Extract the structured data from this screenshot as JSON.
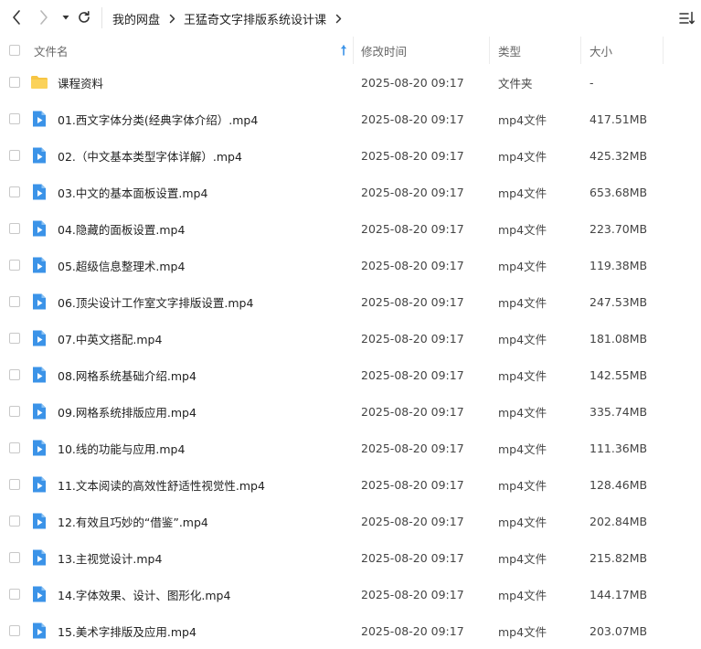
{
  "nav": {
    "back_icon": "chevron-left-icon",
    "forward_icon": "chevron-right-icon",
    "history_icon": "caret-down-icon",
    "refresh_icon": "refresh-icon",
    "view_icon": "sort-list-icon"
  },
  "breadcrumb": {
    "items": [
      "我的网盘",
      "王猛奇文字排版系统设计课"
    ]
  },
  "columns": {
    "name": "文件名",
    "modified": "修改时间",
    "type": "类型",
    "size": "大小"
  },
  "files": [
    {
      "name": "课程资料",
      "modified": "2025-08-20 09:17",
      "type": "文件夹",
      "size": "-",
      "kind": "folder"
    },
    {
      "name": "01.西文字体分类(经典字体介绍）.mp4",
      "modified": "2025-08-20 09:17",
      "type": "mp4文件",
      "size": "417.51MB",
      "kind": "video"
    },
    {
      "name": "02.（中文基本类型字体详解）.mp4",
      "modified": "2025-08-20 09:17",
      "type": "mp4文件",
      "size": "425.32MB",
      "kind": "video"
    },
    {
      "name": "03.中文的基本面板设置.mp4",
      "modified": "2025-08-20 09:17",
      "type": "mp4文件",
      "size": "653.68MB",
      "kind": "video"
    },
    {
      "name": "04.隐藏的面板设置.mp4",
      "modified": "2025-08-20 09:17",
      "type": "mp4文件",
      "size": "223.70MB",
      "kind": "video"
    },
    {
      "name": "05.超级信息整理术.mp4",
      "modified": "2025-08-20 09:17",
      "type": "mp4文件",
      "size": "119.38MB",
      "kind": "video"
    },
    {
      "name": "06.顶尖设计工作室文字排版设置.mp4",
      "modified": "2025-08-20 09:17",
      "type": "mp4文件",
      "size": "247.53MB",
      "kind": "video"
    },
    {
      "name": "07.中英文搭配.mp4",
      "modified": "2025-08-20 09:17",
      "type": "mp4文件",
      "size": "181.08MB",
      "kind": "video"
    },
    {
      "name": "08.网格系统基础介绍.mp4",
      "modified": "2025-08-20 09:17",
      "type": "mp4文件",
      "size": "142.55MB",
      "kind": "video"
    },
    {
      "name": "09.网格系统排版应用.mp4",
      "modified": "2025-08-20 09:17",
      "type": "mp4文件",
      "size": "335.74MB",
      "kind": "video"
    },
    {
      "name": "10.线的功能与应用.mp4",
      "modified": "2025-08-20 09:17",
      "type": "mp4文件",
      "size": "111.36MB",
      "kind": "video"
    },
    {
      "name": "11.文本阅读的高效性舒适性视觉性.mp4",
      "modified": "2025-08-20 09:17",
      "type": "mp4文件",
      "size": "128.46MB",
      "kind": "video"
    },
    {
      "name": "12.有效且巧妙的“借鉴”.mp4",
      "modified": "2025-08-20 09:17",
      "type": "mp4文件",
      "size": "202.84MB",
      "kind": "video"
    },
    {
      "name": "13.主视觉设计.mp4",
      "modified": "2025-08-20 09:17",
      "type": "mp4文件",
      "size": "215.82MB",
      "kind": "video"
    },
    {
      "name": "14.字体效果、设计、图形化.mp4",
      "modified": "2025-08-20 09:17",
      "type": "mp4文件",
      "size": "144.17MB",
      "kind": "video"
    },
    {
      "name": "15.美术字排版及应用.mp4",
      "modified": "2025-08-20 09:17",
      "type": "mp4文件",
      "size": "203.07MB",
      "kind": "video"
    }
  ],
  "colors": {
    "folder": "#f7c543",
    "video": "#3b93e8",
    "sort_arrow": "#3b93e8",
    "text": "#333333",
    "header_text": "#666666"
  }
}
